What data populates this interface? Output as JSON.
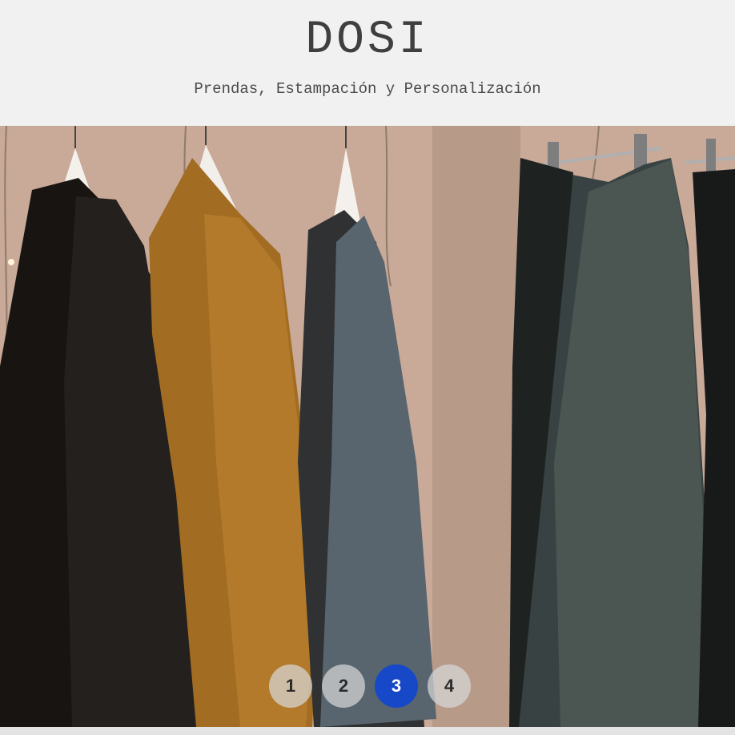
{
  "header": {
    "brand": "DOSI",
    "tagline": "Prendas, Estampación y Personalización"
  },
  "slider": {
    "active_index": 3,
    "dots": [
      {
        "label": "1"
      },
      {
        "label": "2"
      },
      {
        "label": "3"
      },
      {
        "label": "4"
      }
    ]
  },
  "colors": {
    "active_dot": "#1748c7",
    "background": "#f1f1f1",
    "brand_text": "#3f3f3f"
  }
}
